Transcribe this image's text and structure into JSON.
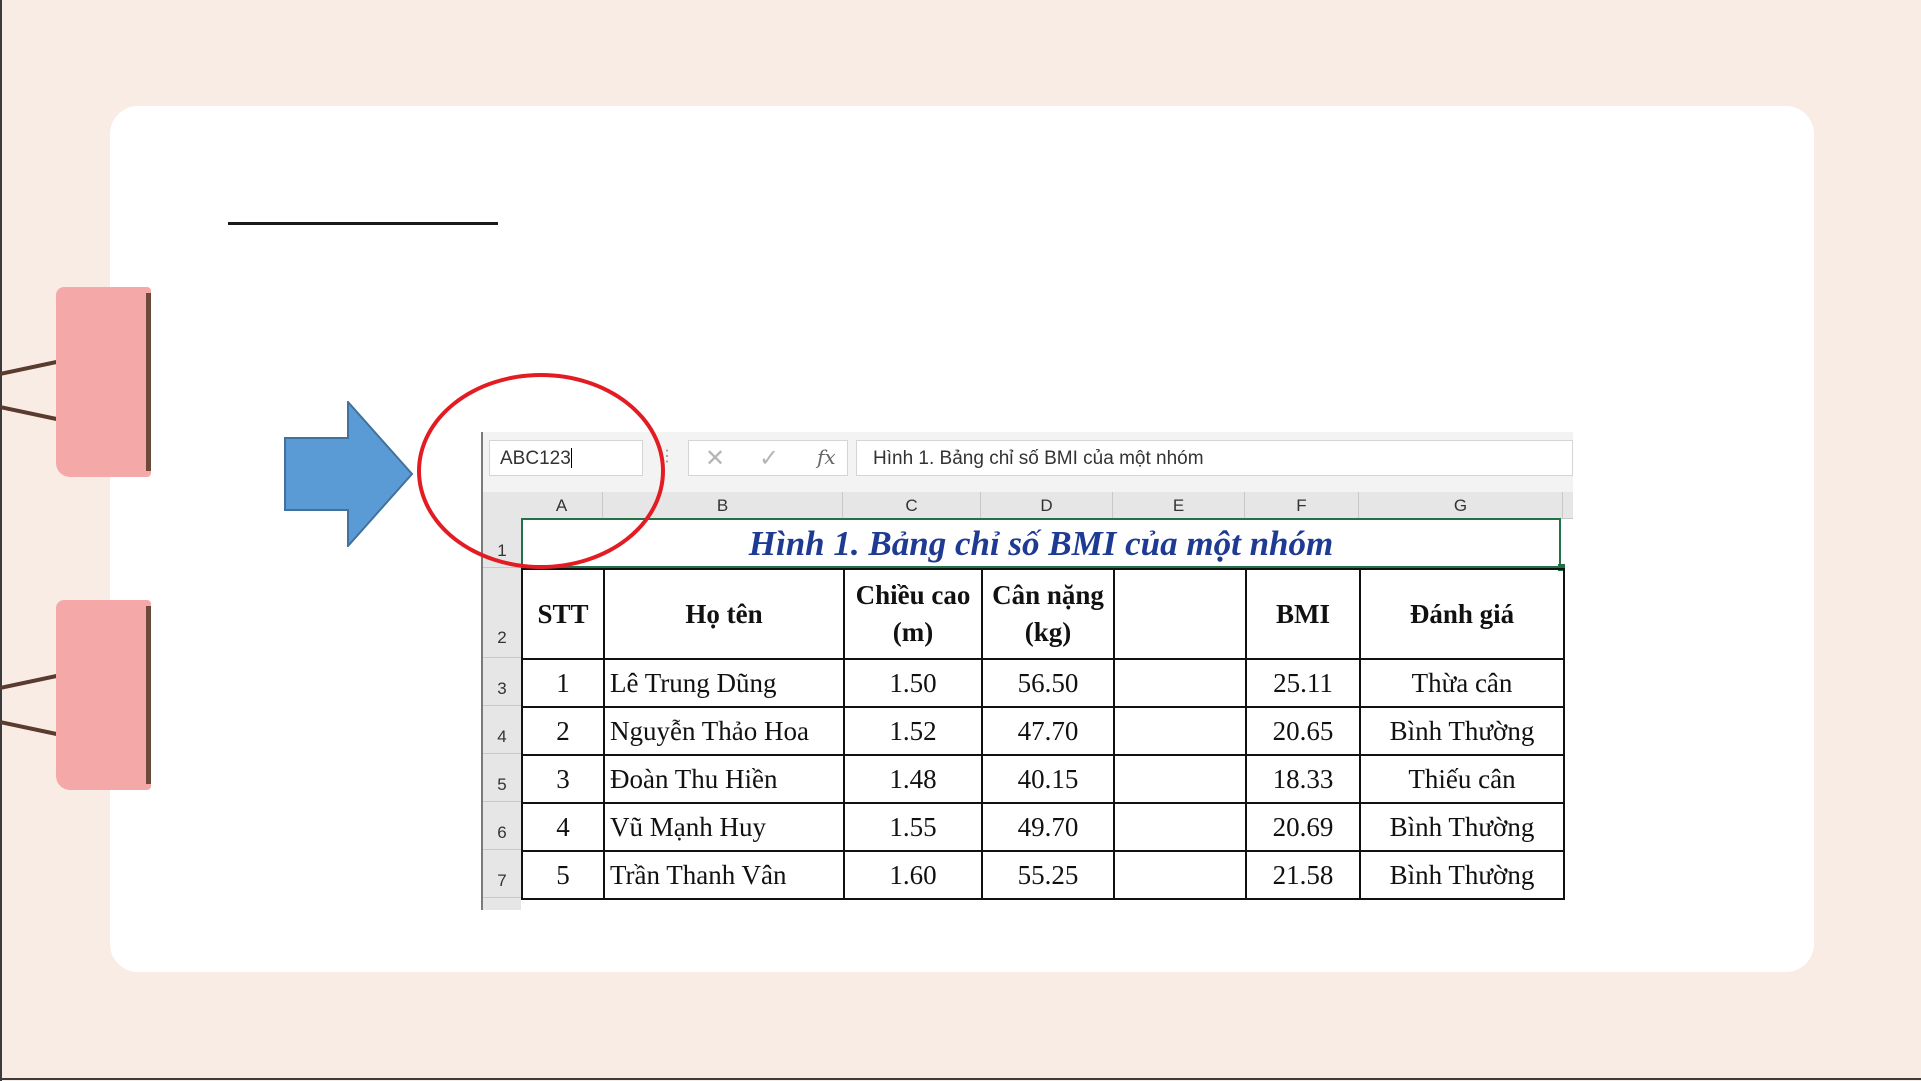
{
  "colors": {
    "background": "#f9ece4",
    "card": "#ffffff",
    "clip": "#f4a9a8",
    "arrow": "#5b9bd5",
    "annotation_ring": "#e31b23",
    "title_text": "#1f3a93",
    "selection": "#217346"
  },
  "decor": {
    "clip_icon": "binder-clip-icon",
    "arrow_icon": "right-arrow-icon"
  },
  "excel": {
    "name_box": "ABC123",
    "formula_buttons": {
      "cancel": "✕",
      "enter": "✓",
      "fx": "fx"
    },
    "formula_bar": "Hình 1. Bảng chỉ số BMI của một nhóm",
    "columns": [
      "A",
      "B",
      "C",
      "D",
      "E",
      "F",
      "G"
    ],
    "rows": [
      "1",
      "2",
      "3",
      "4",
      "5",
      "6",
      "7"
    ],
    "title": "Hình 1. Bảng chỉ số BMI của một nhóm",
    "headers": {
      "stt": "STT",
      "name": "Họ tên",
      "height_1": "Chiều cao",
      "height_2": "(m)",
      "weight_1": "Cân nặng",
      "weight_2": "(kg)",
      "e": "",
      "bmi": "BMI",
      "eval": "Đánh giá"
    },
    "data": [
      {
        "stt": "1",
        "name": "Lê Trung Dũng",
        "height": "1.50",
        "weight": "56.50",
        "e": "",
        "bmi": "25.11",
        "eval": "Thừa cân"
      },
      {
        "stt": "2",
        "name": "Nguyễn Thảo Hoa",
        "height": "1.52",
        "weight": "47.70",
        "e": "",
        "bmi": "20.65",
        "eval": "Bình Thường"
      },
      {
        "stt": "3",
        "name": "Đoàn Thu Hiền",
        "height": "1.48",
        "weight": "40.15",
        "e": "",
        "bmi": "18.33",
        "eval": "Thiếu cân"
      },
      {
        "stt": "4",
        "name": "Vũ Mạnh Huy",
        "height": "1.55",
        "weight": "49.70",
        "e": "",
        "bmi": "20.69",
        "eval": "Bình Thường"
      },
      {
        "stt": "5",
        "name": "Trần Thanh Vân",
        "height": "1.60",
        "weight": "55.25",
        "e": "",
        "bmi": "21.58",
        "eval": "Bình Thường"
      }
    ]
  }
}
